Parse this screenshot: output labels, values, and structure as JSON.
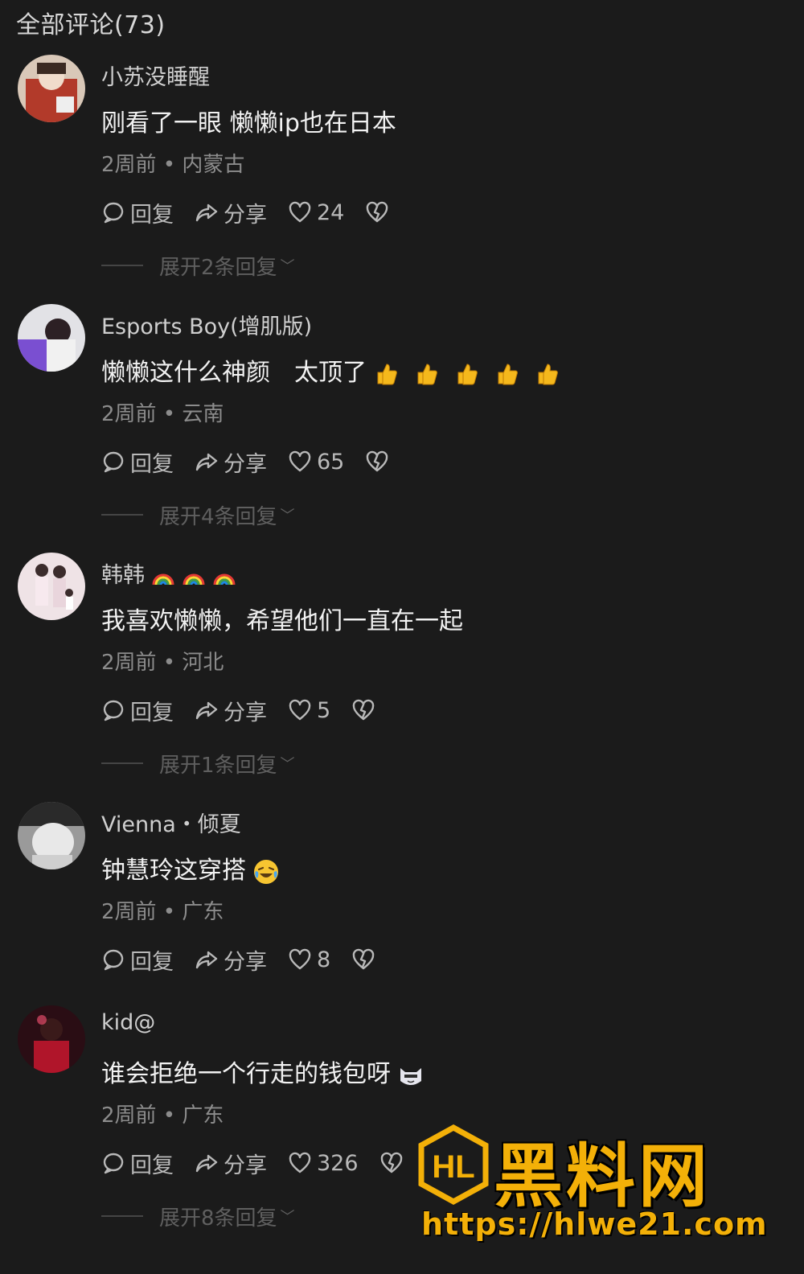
{
  "header": {
    "title": "全部评论(73)"
  },
  "labels": {
    "reply": "回复",
    "share": "分享"
  },
  "comments": [
    {
      "username": "小苏没睡醒",
      "text": "刚看了一眼 懒懒ip也在日本",
      "time": "2周前",
      "location": "内蒙古",
      "likes": "24",
      "expand": "展开2条回复"
    },
    {
      "username": "Esports Boy(增肌版)",
      "text": "懒懒这什么神颜　太顶了",
      "time": "2周前",
      "location": "云南",
      "likes": "65",
      "expand": "展开4条回复",
      "emojis": [
        "thumbs-up-emoji",
        "thumbs-up-emoji",
        "thumbs-up-emoji",
        "thumbs-up-emoji",
        "thumbs-up-emoji"
      ]
    },
    {
      "username": "韩韩",
      "text": "我喜欢懒懒，希望他们一直在一起",
      "time": "2周前",
      "location": "河北",
      "likes": "5",
      "expand": "展开1条回复",
      "username_emojis": [
        "rainbow-emoji",
        "rainbow-emoji",
        "rainbow-emoji"
      ]
    },
    {
      "username": "Vienna・倾夏",
      "text": "钟慧玲这穿搭",
      "time": "2周前",
      "location": "广东",
      "likes": "8",
      "emojis": [
        "laughing-crying-emoji"
      ]
    },
    {
      "username": "kid@",
      "text": "谁会拒绝一个行走的钱包呀",
      "time": "2周前",
      "location": "广东",
      "likes": "326",
      "expand": "展开8条回复",
      "emojis": [
        "cat-face-emoji"
      ]
    }
  ],
  "colors": {
    "background": "#1b1b1b",
    "watermark": "#f3b008"
  },
  "watermark": {
    "title": "黑料网",
    "url": "https://hlwe21.com",
    "logo_text": "HL"
  }
}
